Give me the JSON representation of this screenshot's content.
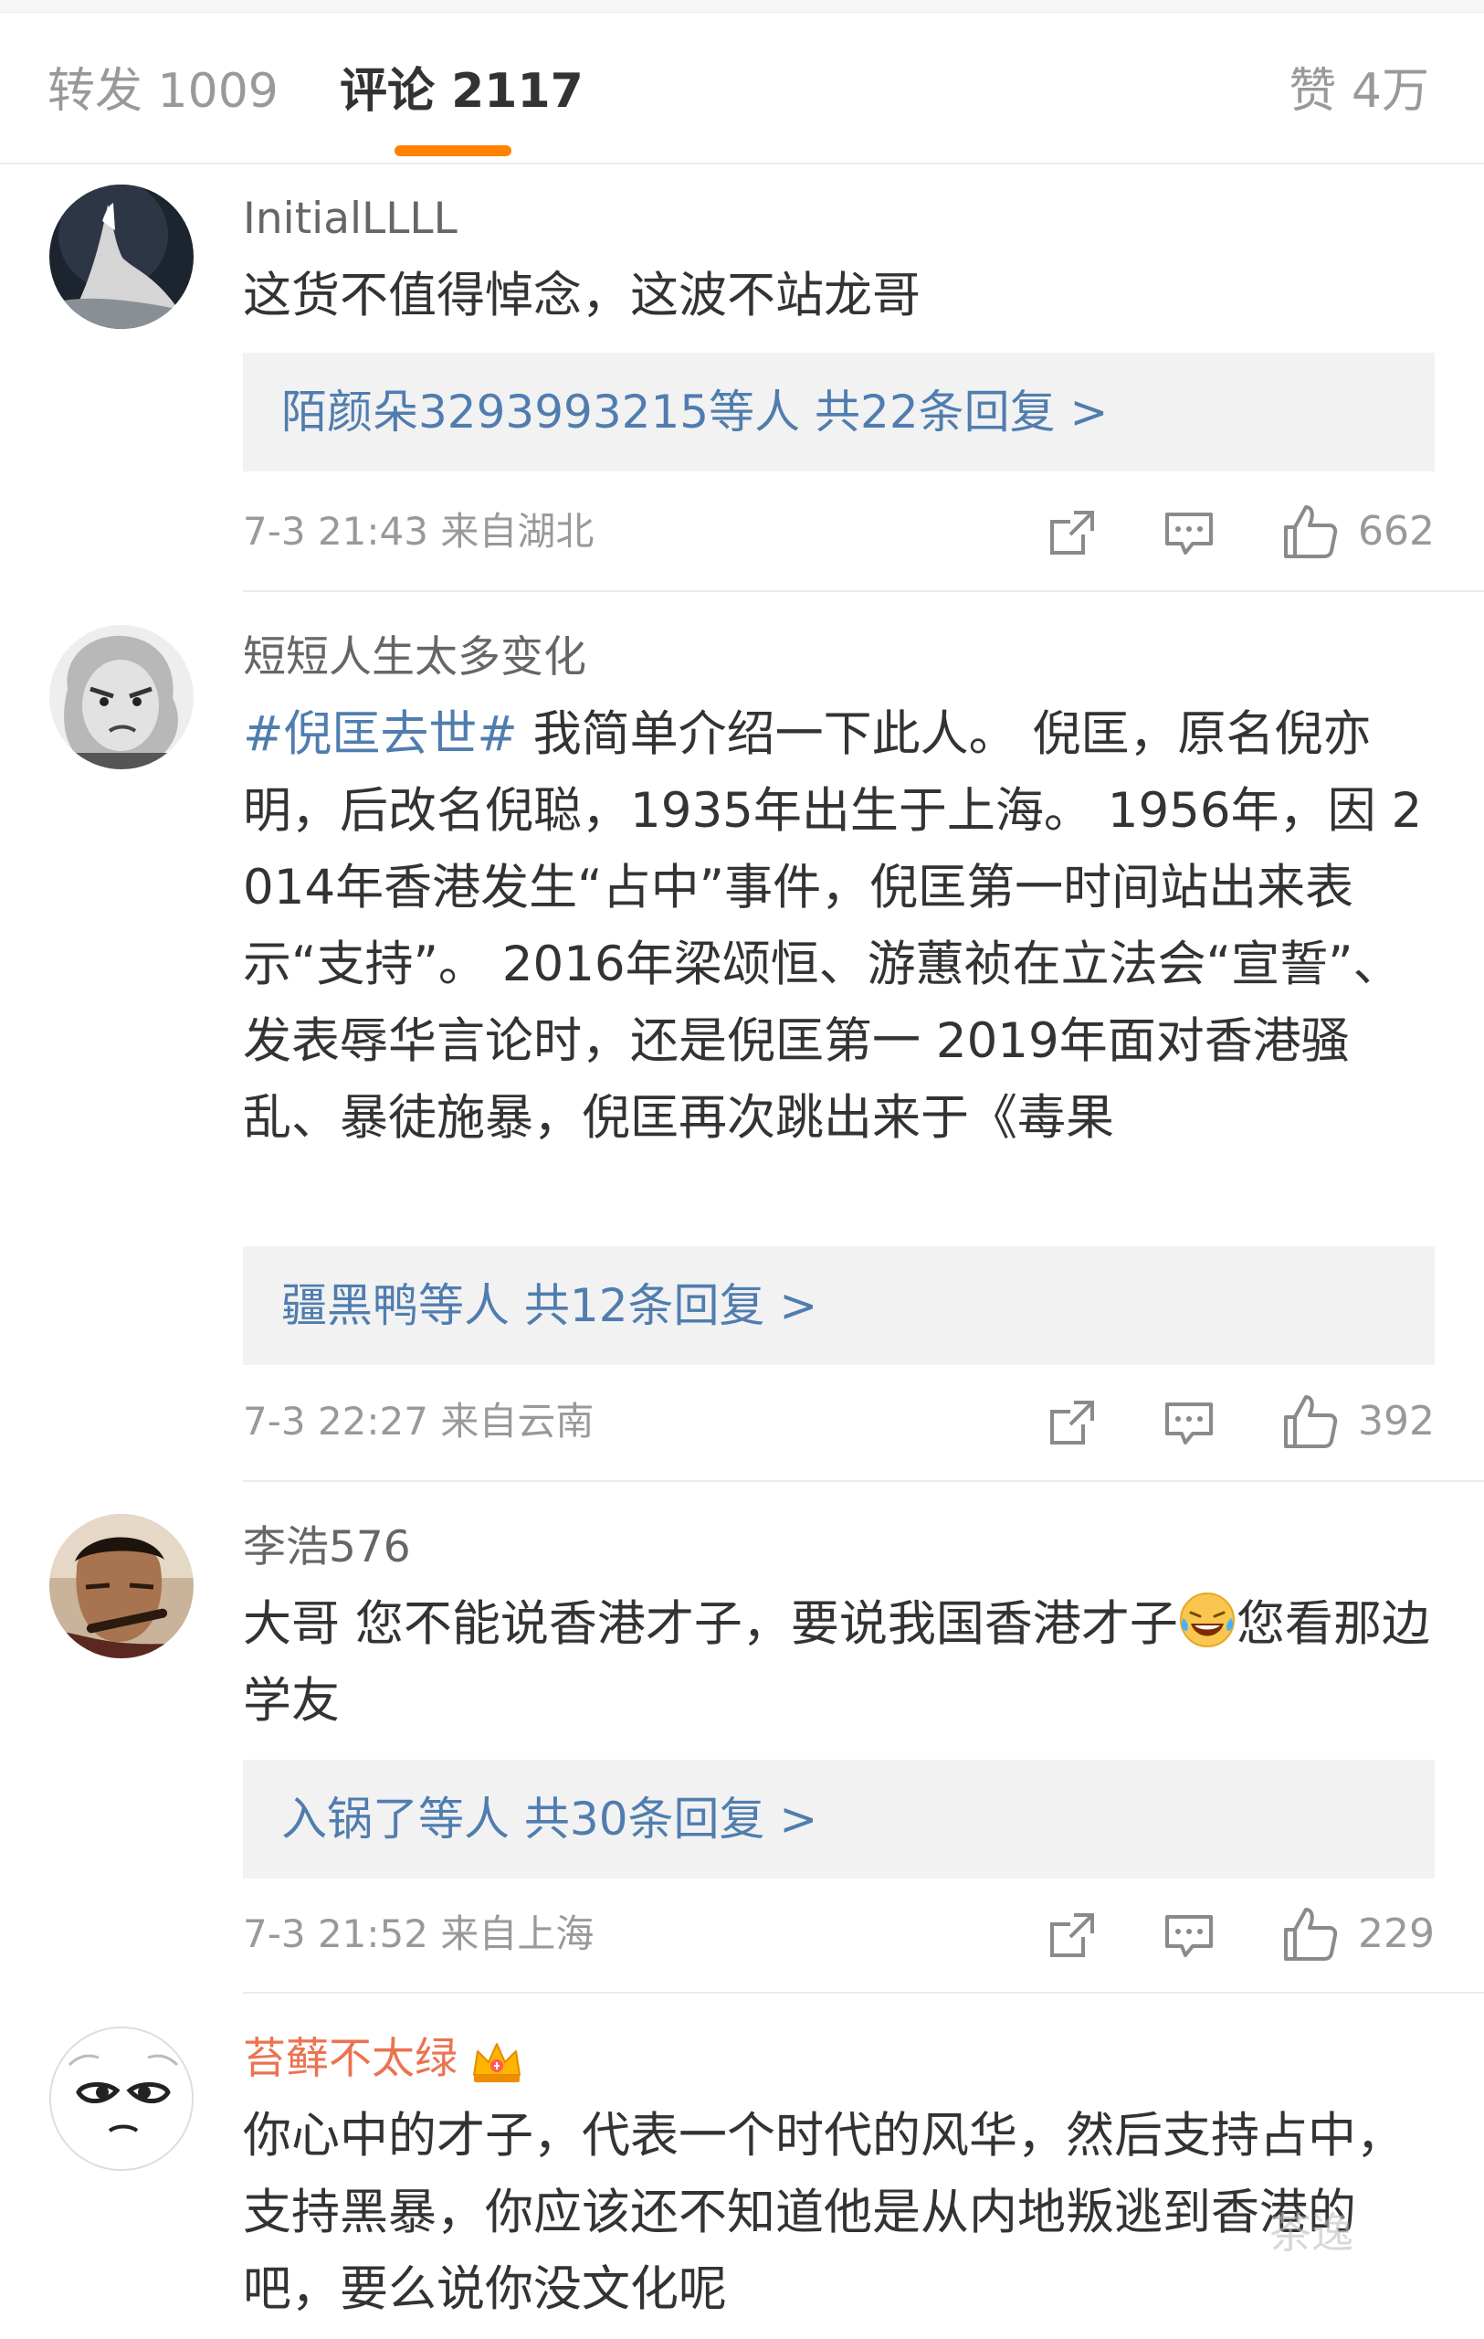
{
  "tabs": {
    "reposts_label": "转发 1009",
    "comments_label": "评论 2117",
    "likes_label": "赞 4万"
  },
  "comments": [
    {
      "username": "InitialLLLL",
      "text": "这货不值得悼念，这波不站龙哥",
      "reply_summary": "陌颜朵3293993215等人  共22条回复 >",
      "meta": "7-3 21:43  来自湖北",
      "likes": "662"
    },
    {
      "username": "短短人生太多变化",
      "hashtag": "#倪匡去世#",
      "text": " 我简单介绍一下此人。 倪匡，原名倪亦明，后改名倪聪，1935年出生于上海。 1956年，因  2014年香港发生“占中”事件，倪匡第一时间站出来表示“支持”。  2016年梁颂恒、游蕙祯在立法会“宣誓”、发表辱华言论时，还是倪匡第一 2019年面对香港骚乱、暴徒施暴，倪匡再次跳出来于《毒果",
      "reply_summary": "疆黑鸭等人  共12条回复 >",
      "meta": "7-3 22:27  来自云南",
      "likes": "392"
    },
    {
      "username": "李浩576",
      "text_before": "大哥 您不能说香港才子，要说我国香港才子",
      "text_after": "您看那边学友",
      "emoji": "laugh-cry-emoji",
      "reply_summary": "入锅了等人  共30条回复 >",
      "meta": "7-3 21:52  来自上海",
      "likes": "229"
    },
    {
      "username": "苔藓不太绿",
      "text": "你心中的才子，代表一个时代的风华，然后支持占中，支持黑暴，你应该还不知道他是从内地叛逃到香港的吧，要么说你没文化呢"
    }
  ],
  "watermark": "茶逸",
  "colors": {
    "accent": "#ff8200",
    "link": "#507daf",
    "vip_name": "#eb7350",
    "muted": "#999999"
  }
}
